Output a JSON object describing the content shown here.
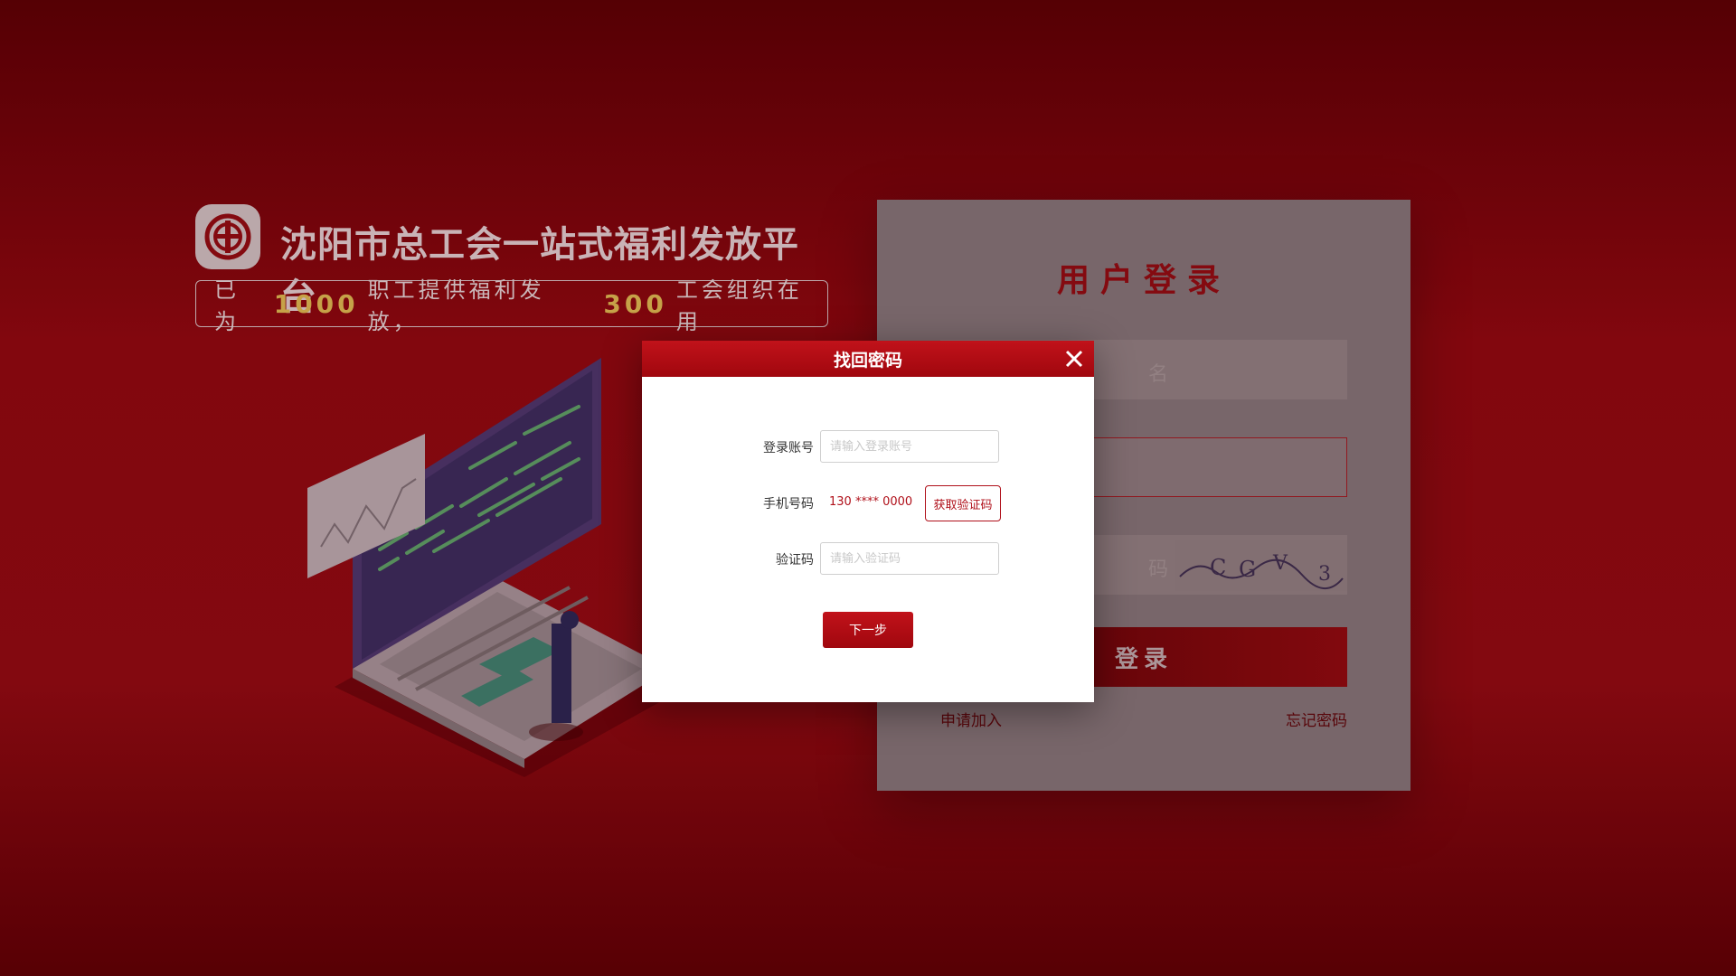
{
  "brand": {
    "title": "沈阳市总工会一站式福利发放平台",
    "tagline_prefix": "已为",
    "employee_count": "1000",
    "tagline_mid": "职工提供福利发放，",
    "union_count": "300",
    "tagline_suffix": "工会组织在用",
    "logo_icon": "union-emblem-icon"
  },
  "login": {
    "title": "用户登录",
    "username_placeholder_visible": "名",
    "captcha_placeholder_visible": "码",
    "captcha_text": "CGV3",
    "submit_label": "登录",
    "apply_link": "申请加入",
    "forgot_link": "忘记密码"
  },
  "modal": {
    "title": "找回密码",
    "account_label": "登录账号",
    "account_placeholder": "请输入登录账号",
    "phone_label": "手机号码",
    "phone_value": "130 **** 0000",
    "get_code_label": "获取验证码",
    "code_label": "验证码",
    "code_placeholder": "请输入验证码",
    "next_label": "下一步"
  },
  "colors": {
    "accent": "#b0101a",
    "background": "#8b0a12"
  }
}
